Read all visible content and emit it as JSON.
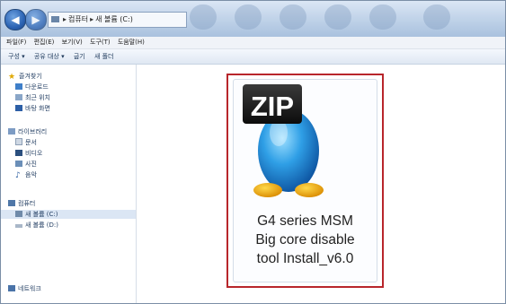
{
  "window": {
    "address": {
      "crumbs": [
        "컴퓨터",
        "새 볼륨 (C:)"
      ],
      "sep": "▸"
    },
    "nav": {
      "back": "◀",
      "forward": "▶"
    }
  },
  "menubar": [
    "파일(F)",
    "편집(E)",
    "보기(V)",
    "도구(T)",
    "도움말(H)"
  ],
  "toolbar": [
    "구성 ▾",
    "공유 대상 ▾",
    "굽기",
    "새 폴더"
  ],
  "sidebar": {
    "favorites": {
      "label": "즐겨찾기",
      "items": [
        "다운로드",
        "최근 위치",
        "바탕 화면"
      ]
    },
    "libraries": {
      "label": "라이브러리",
      "items": [
        "문서",
        "비디오",
        "사진",
        "음악"
      ]
    },
    "computer": {
      "label": "컴퓨터",
      "items": [
        "새 볼륨 (C:)",
        "새 볼륨 (D:)"
      ]
    },
    "network": {
      "label": "네트워크"
    }
  },
  "file": {
    "icon_text": "ZIP",
    "name_lines": [
      "G4 series MSM",
      "Big core disable",
      "tool Install_v6.0"
    ]
  },
  "colors": {
    "highlight": "#b8262b",
    "selection": "#dbe6f4"
  }
}
